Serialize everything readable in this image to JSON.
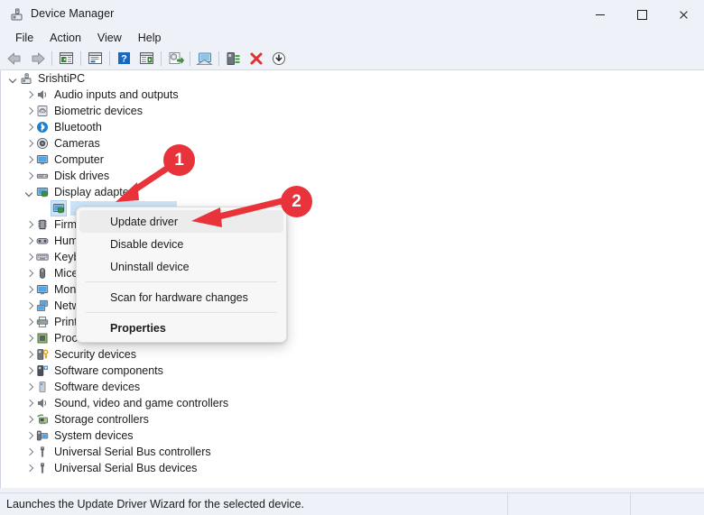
{
  "window": {
    "title": "Device Manager",
    "icon": "device-manager-icon",
    "controls": {
      "minimize": "Minimize",
      "maximize": "Maximize",
      "close": "Close"
    }
  },
  "menubar": {
    "items": [
      {
        "label": "File"
      },
      {
        "label": "Action"
      },
      {
        "label": "View"
      },
      {
        "label": "Help"
      }
    ]
  },
  "toolbar": {
    "buttons": [
      {
        "name": "back-button",
        "icon": "back-arrow-icon"
      },
      {
        "name": "forward-button",
        "icon": "forward-arrow-icon"
      },
      {
        "name": "separator-1",
        "icon": "separator"
      },
      {
        "name": "show-hide-console-tree-button",
        "icon": "console-tree-icon"
      },
      {
        "name": "separator-2",
        "icon": "separator"
      },
      {
        "name": "properties-button",
        "icon": "properties-window-icon"
      },
      {
        "name": "separator-3",
        "icon": "separator"
      },
      {
        "name": "help-button",
        "icon": "question-mark-icon"
      },
      {
        "name": "show-hide-action-pane-button",
        "icon": "action-pane-icon"
      },
      {
        "name": "separator-4",
        "icon": "separator"
      },
      {
        "name": "update-driver-button",
        "icon": "update-driver-icon"
      },
      {
        "name": "separator-5",
        "icon": "separator"
      },
      {
        "name": "scan-for-hardware-changes-button",
        "icon": "scan-hardware-icon"
      },
      {
        "name": "separator-6",
        "icon": "separator"
      },
      {
        "name": "enable-device-button",
        "icon": "enable-device-icon"
      },
      {
        "name": "uninstall-device-button",
        "icon": "red-x-icon"
      },
      {
        "name": "download-button",
        "icon": "download-arrow-icon"
      }
    ]
  },
  "tree": {
    "root": {
      "label": "SrishtiPC",
      "icon": "computer-root-icon",
      "expanded": true
    },
    "items": [
      {
        "label": "Audio inputs and outputs",
        "icon": "speaker-icon",
        "expanded": false
      },
      {
        "label": "Biometric devices",
        "icon": "fingerprint-icon",
        "expanded": false
      },
      {
        "label": "Bluetooth",
        "icon": "bluetooth-icon",
        "expanded": false
      },
      {
        "label": "Cameras",
        "icon": "camera-icon",
        "expanded": false
      },
      {
        "label": "Computer",
        "icon": "monitor-icon",
        "expanded": false
      },
      {
        "label": "Disk drives",
        "icon": "disk-drive-icon",
        "expanded": false
      },
      {
        "label": "Display adapters",
        "icon": "display-adapter-icon",
        "expanded": true
      },
      {
        "label": "",
        "icon": "display-adapter-child-icon",
        "selected": true,
        "child": true
      },
      {
        "label": "Firmware",
        "icon": "firmware-icon",
        "expanded": false,
        "truncated": true
      },
      {
        "label": "Human Interface Devices",
        "icon": "hid-icon",
        "expanded": false,
        "truncated": true
      },
      {
        "label": "Keyboards",
        "icon": "keyboard-icon",
        "expanded": false,
        "truncated": true
      },
      {
        "label": "Mice and other pointing devices",
        "icon": "mouse-icon",
        "expanded": false,
        "truncated": true
      },
      {
        "label": "Monitors",
        "icon": "monitor-icon",
        "expanded": false,
        "truncated": true
      },
      {
        "label": "Network adapters",
        "icon": "network-adapter-icon",
        "expanded": false,
        "truncated": true
      },
      {
        "label": "Print queues",
        "icon": "printer-icon",
        "expanded": false,
        "truncated": true
      },
      {
        "label": "Processors",
        "icon": "processor-icon",
        "expanded": false
      },
      {
        "label": "Security devices",
        "icon": "security-device-icon",
        "expanded": false
      },
      {
        "label": "Software components",
        "icon": "software-component-icon",
        "expanded": false
      },
      {
        "label": "Software devices",
        "icon": "software-device-icon",
        "expanded": false
      },
      {
        "label": "Sound, video and game controllers",
        "icon": "speaker-icon",
        "expanded": false
      },
      {
        "label": "Storage controllers",
        "icon": "storage-controller-icon",
        "expanded": false
      },
      {
        "label": "System devices",
        "icon": "system-device-icon",
        "expanded": false
      },
      {
        "label": "Universal Serial Bus controllers",
        "icon": "usb-icon",
        "expanded": false
      },
      {
        "label": "Universal Serial Bus devices",
        "icon": "usb-icon",
        "expanded": false
      }
    ]
  },
  "context_menu": {
    "items": [
      {
        "label": "Update driver",
        "highlighted": true,
        "bold": false
      },
      {
        "label": "Disable device",
        "highlighted": false,
        "bold": false
      },
      {
        "label": "Uninstall device",
        "highlighted": false,
        "bold": false
      },
      {
        "separator": true
      },
      {
        "label": "Scan for hardware changes",
        "highlighted": false,
        "bold": false
      },
      {
        "separator": true
      },
      {
        "label": "Properties",
        "highlighted": false,
        "bold": true
      }
    ]
  },
  "statusbar": {
    "message": "Launches the Update Driver Wizard for the selected device."
  },
  "annotations": {
    "color": "#e8333a",
    "badges": [
      {
        "number": "1",
        "points_to": "Display adapters"
      },
      {
        "number": "2",
        "points_to": "Update driver"
      }
    ]
  }
}
